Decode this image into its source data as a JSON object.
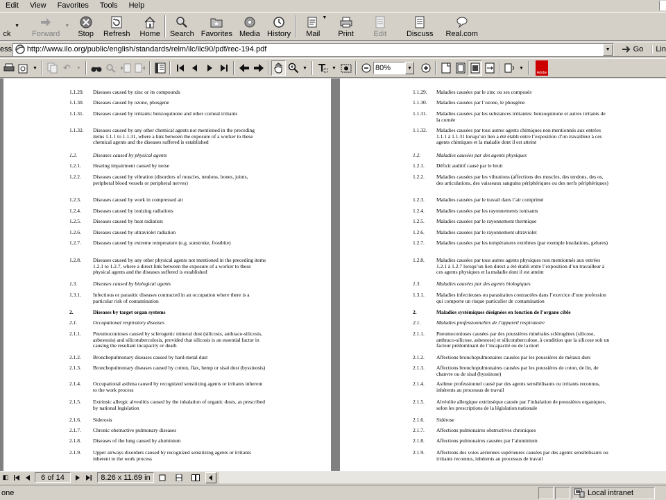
{
  "menu": {
    "items": [
      "Edit",
      "View",
      "Favorites",
      "Tools",
      "Help"
    ]
  },
  "toolbar": {
    "back_label": "ck",
    "forward_label": "Forward",
    "stop_label": "Stop",
    "refresh_label": "Refresh",
    "home_label": "Home",
    "search_label": "Search",
    "favorites_label": "Favorites",
    "media_label": "Media",
    "history_label": "History",
    "mail_label": "Mail",
    "print_label": "Print",
    "edit_label": "Edit",
    "discuss_label": "Discuss",
    "realcom_label": "Real.com"
  },
  "address": {
    "label": "ess",
    "url": "http://www.ilo.org/public/english/standards/relm/ilc/ilc90/pdf/rec-194.pdf",
    "go_label": "Go",
    "links_label": "Lin"
  },
  "pdf_toolbar": {
    "zoom": "80%"
  },
  "document": {
    "english": [
      {
        "n": "1.1.29.",
        "t": "Diseases caused by zinc or its compounds",
        "style": ""
      },
      {
        "n": "1.1.30.",
        "t": "Diseases caused by ozone, phosgene",
        "style": ""
      },
      {
        "n": "1.1.31.",
        "t": "Diseases caused by irritants: benzoquinone and other corneal irritants",
        "style": ""
      },
      {
        "n": "1.1.32.",
        "t": "Diseases caused by any other chemical agents not mentioned in the preceding items 1.1.1 to 1.1.31, where a link between the exposure of a worker to these chemical agents and the diseases suffered is established",
        "style": ""
      },
      {
        "n": "1.2.",
        "t": "Diseases caused by physical agents",
        "style": "italic"
      },
      {
        "n": "1.2.1.",
        "t": "Hearing impairment caused by noise",
        "style": ""
      },
      {
        "n": "1.2.2.",
        "t": "Diseases caused by vibration (disorders of muscles, tendons, bones, joints, peripheral blood vessels or peripheral nerves)",
        "style": ""
      },
      {
        "n": "1.2.3.",
        "t": "Diseases caused by work in compressed air",
        "style": ""
      },
      {
        "n": "1.2.4.",
        "t": "Diseases caused by ionizing radiations",
        "style": ""
      },
      {
        "n": "1.2.5.",
        "t": "Diseases caused by heat radiation",
        "style": ""
      },
      {
        "n": "1.2.6.",
        "t": "Diseases caused by ultraviolet radiation",
        "style": ""
      },
      {
        "n": "1.2.7.",
        "t": "Diseases caused by extreme temperature (e.g. sunstroke, frostbite)",
        "style": ""
      },
      {
        "n": "1.2.8.",
        "t": "Diseases caused by any other physical agents not mentioned in the preceding items 1.2.1 to 1.2.7, where a direct link between the exposure of a worker to these physical agents and the diseases suffered is established",
        "style": ""
      },
      {
        "n": "1.3.",
        "t": "Diseases caused by biological agents",
        "style": "italic"
      },
      {
        "n": "1.3.1.",
        "t": "Infectious or parasitic diseases contracted in an occupation where there is a particular risk of contamination",
        "style": ""
      },
      {
        "n": "2.",
        "t": "Diseases by target organ systems",
        "style": "bold"
      },
      {
        "n": "2.1.",
        "t": "Occupational respiratory diseases",
        "style": "italic"
      },
      {
        "n": "2.1.1.",
        "t": "Pneumoconioses caused by sclerogenic mineral dust (silicosis, anthraco-silicosis, asbestosis) and silicotuberculosis, provided that silicosis is an essential factor in causing the resultant incapacity or death",
        "style": ""
      },
      {
        "n": "2.1.2.",
        "t": "Bronchopulmonary diseases caused by hard-metal dust",
        "style": ""
      },
      {
        "n": "2.1.3.",
        "t": "Bronchopulmonary diseases caused by cotton, flax, hemp or sisal dust (byssinosis)",
        "style": ""
      },
      {
        "n": "2.1.4.",
        "t": "Occupational asthma caused by recognized sensitizing agents or irritants inherent to the work process",
        "style": ""
      },
      {
        "n": "2.1.5.",
        "t": "Extrinsic allergic alveolitis caused by the inhalation of organic dusts, as prescribed by national legislation",
        "style": ""
      },
      {
        "n": "2.1.6.",
        "t": "Siderosis",
        "style": ""
      },
      {
        "n": "2.1.7.",
        "t": "Chronic obstructive pulmonary diseases",
        "style": ""
      },
      {
        "n": "2.1.8.",
        "t": "Diseases of the lung caused by aluminium",
        "style": ""
      },
      {
        "n": "2.1.9.",
        "t": "Upper airways disorders caused by recognized sensitizing agents or irritants inherent to the work process",
        "style": ""
      }
    ],
    "french": [
      {
        "n": "1.1.29.",
        "t": "Maladies causées par le zinc ou ses composés",
        "style": ""
      },
      {
        "n": "1.1.30.",
        "t": "Maladies causées par l’ozone, le phosgène",
        "style": ""
      },
      {
        "n": "1.1.31.",
        "t": "Maladies causées par les substances irritantes: benzoquinone et autres irritants de la cornée",
        "style": ""
      },
      {
        "n": "1.1.32.",
        "t": "Maladies causées par tous autres agents chimiques non mentionnés aux entrées 1.1.1 à 1.1.31 lorsqu’un lien a été établi entre l’exposition d’un travailleur à ces agents chimiques et la maladie dont il est atteint",
        "style": ""
      },
      {
        "n": "1.2.",
        "t": "Maladies causées par des agents physiques",
        "style": "italic"
      },
      {
        "n": "1.2.1.",
        "t": "Déficit auditif causé par le bruit",
        "style": ""
      },
      {
        "n": "1.2.2.",
        "t": "Maladies causées par les vibrations (affections des muscles, des tendons, des os, des articulations, des vaisseaux sanguins périphériques ou des nerfs périphériques)",
        "style": ""
      },
      {
        "n": "1.2.3.",
        "t": "Maladies causées par le travail dans l’air comprimé",
        "style": ""
      },
      {
        "n": "1.2.4.",
        "t": "Maladies causées par les rayonnements ionisants",
        "style": ""
      },
      {
        "n": "1.2.5.",
        "t": "Maladies causées par le rayonnement thermique",
        "style": ""
      },
      {
        "n": "1.2.6.",
        "t": "Maladies causées par le rayonnement ultraviolet",
        "style": ""
      },
      {
        "n": "1.2.7.",
        "t": "Maladies causées par les températures extrêmes (par exemple insolations, gelures)",
        "style": ""
      },
      {
        "n": "1.2.8.",
        "t": "Maladies causées par tous autres agents physiques non mentionnés aux entrées 1.2.1 à 1.2.7 lorsqu’un lien direct a été établi entre l’exposition d’un travailleur à ces agents physiques et la maladie dont il est atteint",
        "style": ""
      },
      {
        "n": "1.3.",
        "t": "Maladies causées par des agents biologiques",
        "style": "italic"
      },
      {
        "n": "1.3.1.",
        "t": "Maladies infectieuses ou parasitaires contractées dans l’exercice d’une profession qui comporte un risque particulier de contamination",
        "style": ""
      },
      {
        "n": "2.",
        "t": "Maladies systémiques désignées en fonction de l’organe cible",
        "style": "bold"
      },
      {
        "n": "2.1.",
        "t": "Maladies professionnelles de l’appareil respiratoire",
        "style": "italic"
      },
      {
        "n": "2.1.1.",
        "t": "Pneumoconioses causées par des poussières minérales sclérogènes (silicose, anthraco-silicose, asbestose) et silicotuberculose, à condition que la silicose soit un facteur prédominant de l’incapacité ou de la mort",
        "style": ""
      },
      {
        "n": "2.1.2.",
        "t": "Affections bronchopulmonaires causées par les poussières de métaux durs",
        "style": ""
      },
      {
        "n": "2.1.3.",
        "t": "Affections bronchopulmonaires causées par les poussières de coton, de lin, de chanvre ou de sisal (byssinose)",
        "style": ""
      },
      {
        "n": "2.1.4.",
        "t": "Asthme professionnel causé par des agents sensibilisants ou irritants reconnus, inhérents au processus de travail",
        "style": ""
      },
      {
        "n": "2.1.5.",
        "t": "Alvéolite allergique extrinsèque causée par l’inhalation de poussières organiques, selon les prescriptions de la législation nationale",
        "style": ""
      },
      {
        "n": "2.1.6.",
        "t": "Sidérose",
        "style": ""
      },
      {
        "n": "2.1.7.",
        "t": "Affections pulmonaires obstructives chroniques",
        "style": ""
      },
      {
        "n": "2.1.8.",
        "t": "Affections pulmonaires causées par l’aluminium",
        "style": ""
      },
      {
        "n": "2.1.9.",
        "t": "Affections des voies aériennes supérieures causées par des agents sensibilisants ou irritants reconnus, inhérents au processus de travail",
        "style": ""
      }
    ]
  },
  "nav": {
    "page_count": "6 of 14",
    "page_size": "8.26 x 11.69 in"
  },
  "status": {
    "text": "one",
    "zone": "Local intranet"
  },
  "colors": {
    "chrome": "#d4d0c8",
    "doc_bg": "#808080",
    "adobe_red": "#cc0000"
  }
}
